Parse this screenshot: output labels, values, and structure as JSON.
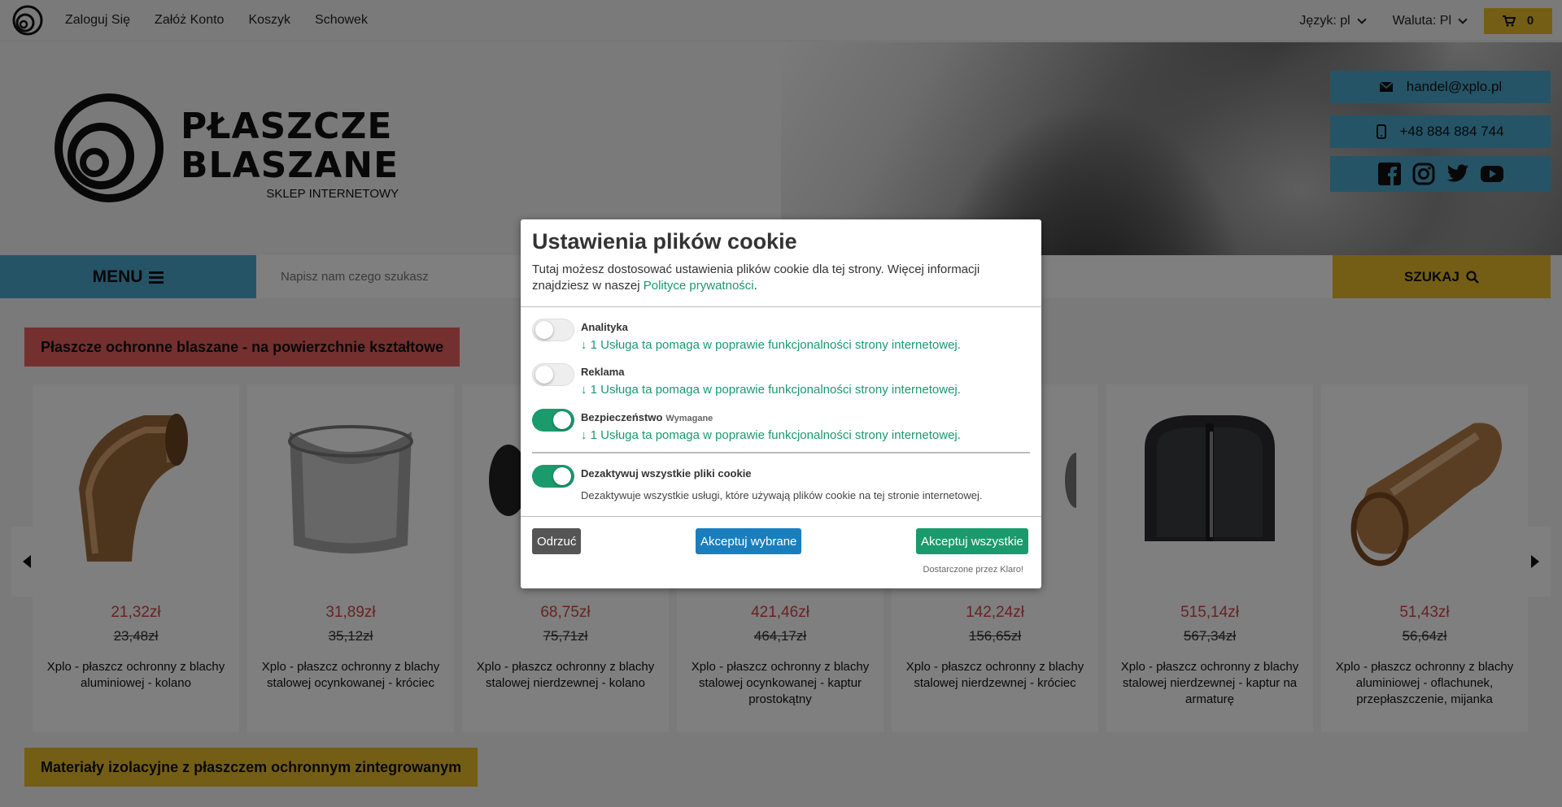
{
  "topbar": {
    "links": [
      "Zaloguj Się",
      "Załóż Konto",
      "Koszyk",
      "Schowek"
    ],
    "language": "Język: pl",
    "currency": "Waluta: Pl",
    "cart_count": "0"
  },
  "header": {
    "logo_line1": "PŁASZCZE",
    "logo_line2": "BLASZANE",
    "logo_sub": "SKLEP INTERNETOWY",
    "email": "handel@xplo.pl",
    "phone": "+48 884 884 744"
  },
  "nav": {
    "menu_label": "MENU",
    "search_placeholder": "Napisz nam czego szukasz",
    "search_button": "SZUKAJ"
  },
  "sections": {
    "first": "Płaszcze ochronne blaszane - na powierzchnie kształtowe",
    "second": "Materiały izolacyjne z płaszczem ochronnym zintegrowanym"
  },
  "products": [
    {
      "price": "21,32zł",
      "old_price": "23,48zł",
      "title": "Xplo - płaszcz ochronny z blachy aluminiowej - kolano"
    },
    {
      "price": "31,89zł",
      "old_price": "35,12zł",
      "title": "Xplo - płaszcz ochronny z blachy stalowej ocynkowanej - króciec"
    },
    {
      "price": "68,75zł",
      "old_price": "75,71zł",
      "title": "Xplo - płaszcz ochronny z blachy stalowej nierdzewnej - kolano"
    },
    {
      "price": "421,46zł",
      "old_price": "464,17zł",
      "title": "Xplo - płaszcz ochronny z blachy stalowej ocynkowanej - kaptur prostokątny"
    },
    {
      "price": "142,24zł",
      "old_price": "156,65zł",
      "title": "Xplo - płaszcz ochronny z blachy stalowej nierdzewnej - króciec"
    },
    {
      "price": "515,14zł",
      "old_price": "567,34zł",
      "title": "Xplo - płaszcz ochronny z blachy stalowej nierdzewnej - kaptur na armaturę"
    },
    {
      "price": "51,43zł",
      "old_price": "56,64zł",
      "title": "Xplo - płaszcz ochronny z blachy aluminiowej - oflachunek, przepłaszczenie, mijanka"
    }
  ],
  "cookie_modal": {
    "title": "Ustawienia plików cookie",
    "desc_prefix": "Tutaj możesz dostosować ustawienia plików cookie dla tej strony. Więcej informacji znajdziesz w naszej ",
    "privacy_link": "Polityce prywatności",
    "desc_suffix": ".",
    "services": [
      {
        "name": "Analityka",
        "required": "",
        "link": "↓ 1 Usługa ta pomaga w poprawie funkcjonalności strony internetowej.",
        "enabled": false
      },
      {
        "name": "Reklama",
        "required": "",
        "link": "↓ 1 Usługa ta pomaga w poprawie funkcjonalności strony internetowej.",
        "enabled": false
      },
      {
        "name": "Bezpieczeństwo",
        "required": "Wymagane",
        "link": "↓ 1 Usługa ta pomaga w poprawie funkcjonalności strony internetowej.",
        "enabled": true
      }
    ],
    "disable_all": {
      "name": "Dezaktywuj wszystkie pliki cookie",
      "desc": "Dezaktywuje wszystkie usługi, które używają plików cookie na tej stronie internetowej.",
      "enabled": true
    },
    "buttons": {
      "reject": "Odrzuć",
      "accept_selected": "Akceptuj wybrane",
      "accept_all": "Akceptuj wszystkie"
    },
    "powered_by": "Dostarczone przez Klaro!"
  },
  "colors": {
    "accent_blue": "#4ba8cf",
    "accent_yellow": "#e8bd2a",
    "accent_red": "#e85e5e",
    "green": "#1a9a6d"
  }
}
